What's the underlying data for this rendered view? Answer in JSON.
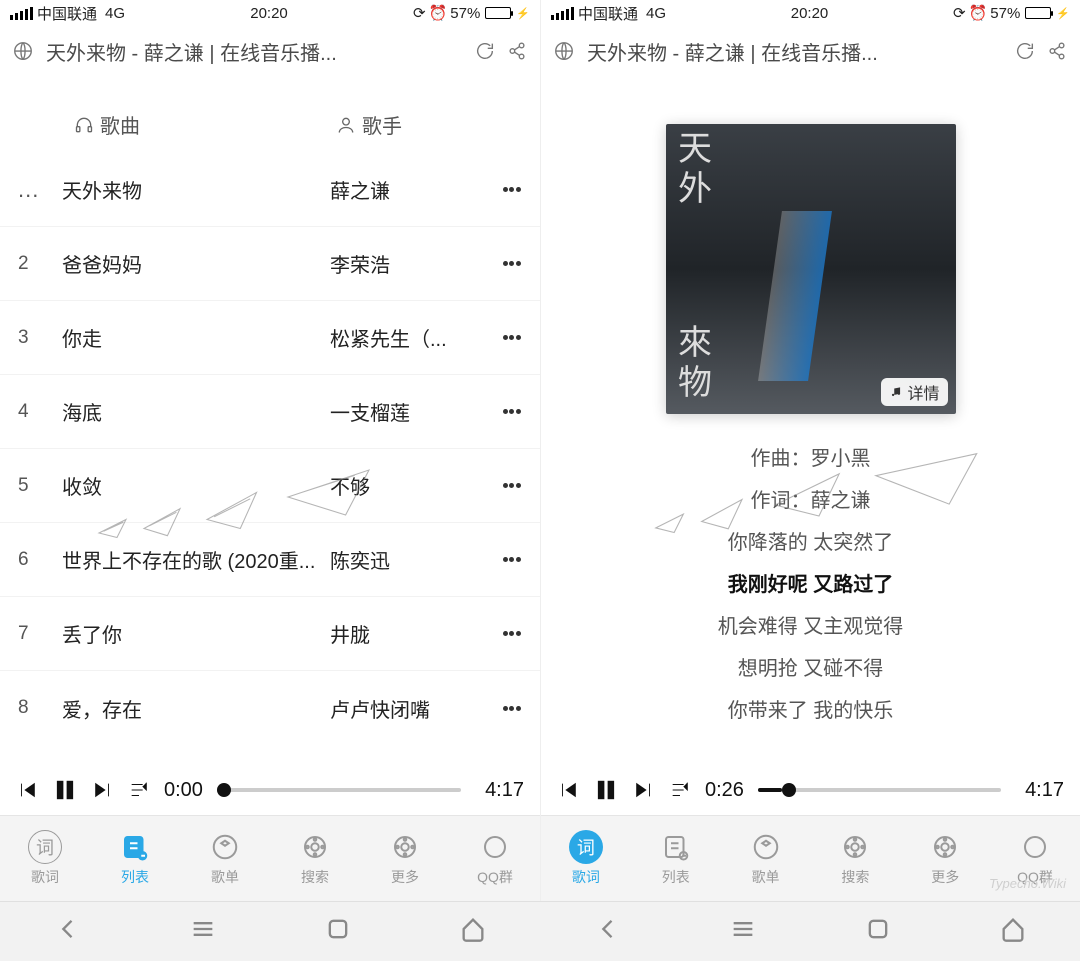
{
  "statusbar": {
    "carrier": "中国联通",
    "network": "4G",
    "time": "20:20",
    "battery_pct": "57%"
  },
  "titlebar": {
    "title": "天外来物 - 薛之谦 | 在线音乐播..."
  },
  "list_header": {
    "song": "歌曲",
    "artist": "歌手"
  },
  "songs": [
    {
      "idx": "...",
      "name": "天外来物",
      "artist": "薛之谦",
      "playing": true
    },
    {
      "idx": "2",
      "name": "爸爸妈妈",
      "artist": "李荣浩"
    },
    {
      "idx": "3",
      "name": "你走",
      "artist": "松紧先生（..."
    },
    {
      "idx": "4",
      "name": "海底",
      "artist": "一支榴莲"
    },
    {
      "idx": "5",
      "name": "收敛",
      "artist": "不够"
    },
    {
      "idx": "6",
      "name": "世界上不存在的歌 (2020重...",
      "artist": "陈奕迅"
    },
    {
      "idx": "7",
      "name": "丢了你",
      "artist": "井胧"
    },
    {
      "idx": "8",
      "name": "爱，存在",
      "artist": "卢卢快闭嘴"
    }
  ],
  "player_left": {
    "cur": "0:00",
    "dur": "4:17",
    "progress_pct": 0
  },
  "player_right": {
    "cur": "0:26",
    "dur": "4:17",
    "progress_pct": 10
  },
  "album": {
    "line1": "天外",
    "line2": "來物",
    "detail_label": "详情"
  },
  "lyrics": {
    "composer": "作曲：罗小黑",
    "lyricist": "作词：薛之谦",
    "lines": [
      "你降落的 太突然了",
      "我刚好呢 又路过了",
      "机会难得 又主观觉得",
      "想明抢 又碰不得",
      "你带来了 我的快乐"
    ],
    "active_index": 1
  },
  "tabs": [
    {
      "key": "lyrics",
      "label": "歌词"
    },
    {
      "key": "list",
      "label": "列表"
    },
    {
      "key": "album",
      "label": "歌单"
    },
    {
      "key": "search",
      "label": "搜索"
    },
    {
      "key": "more",
      "label": "更多"
    },
    {
      "key": "qq",
      "label": "QQ群"
    }
  ],
  "left_active_tab": "list",
  "right_active_tab": "lyrics",
  "watermark": "Typecho.Wiki"
}
